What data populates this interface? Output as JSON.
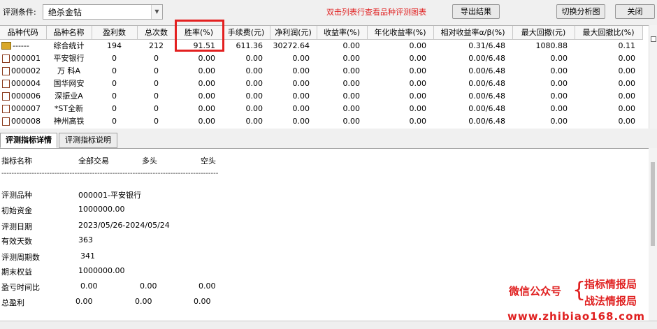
{
  "toolbar": {
    "condition_label": "评测条件:",
    "condition_value": "绝杀金钻",
    "hint": "双击列表行查看品种评测图表",
    "export_label": "导出结果",
    "switch_label": "切换分析图",
    "close_label": "关闭"
  },
  "grid": {
    "columns": [
      "品种代码",
      "品种名称",
      "盈利数",
      "总次数",
      "胜率(%)",
      "手续费(元)",
      "净利润(元)",
      "收益率(%)",
      "年化收益率(%)",
      "相对收益率α/β(%)",
      "最大回撤(元)",
      "最大回撤比(%)"
    ],
    "rows": [
      [
        "------",
        "综合统计",
        "194",
        "212",
        "91.51",
        "611.36",
        "30272.64",
        "0.00",
        "0.00",
        "0.31/6.48",
        "1080.88",
        "0.11"
      ],
      [
        "000001",
        "平安银行",
        "0",
        "0",
        "0.00",
        "0.00",
        "0.00",
        "0.00",
        "0.00",
        "0.00/6.48",
        "0.00",
        "0.00"
      ],
      [
        "000002",
        "万 科A",
        "0",
        "0",
        "0.00",
        "0.00",
        "0.00",
        "0.00",
        "0.00",
        "0.00/6.48",
        "0.00",
        "0.00"
      ],
      [
        "000004",
        "国华网安",
        "0",
        "0",
        "0.00",
        "0.00",
        "0.00",
        "0.00",
        "0.00",
        "0.00/6.48",
        "0.00",
        "0.00"
      ],
      [
        "000006",
        "深振业A",
        "0",
        "0",
        "0.00",
        "0.00",
        "0.00",
        "0.00",
        "0.00",
        "0.00/6.48",
        "0.00",
        "0.00"
      ],
      [
        "000007",
        "*ST全新",
        "0",
        "0",
        "0.00",
        "0.00",
        "0.00",
        "0.00",
        "0.00",
        "0.00/6.48",
        "0.00",
        "0.00"
      ],
      [
        "000008",
        "神州高铁",
        "0",
        "0",
        "0.00",
        "0.00",
        "0.00",
        "0.00",
        "0.00",
        "0.00/6.48",
        "0.00",
        "0.00"
      ]
    ]
  },
  "tabs": [
    "评测指标详情",
    "评测指标说明"
  ],
  "details": {
    "headers": [
      "指标名称",
      "全部交易",
      "多头",
      "空头"
    ],
    "dashes": "--------------------------------------------------------------------------------------",
    "items": [
      {
        "label": "评测品种",
        "values": [
          "000001-平安银行"
        ]
      },
      {
        "label": "初始资金",
        "values": [
          "1000000.00"
        ]
      },
      {
        "label": "评测日期",
        "values": [
          "2023/05/26-2024/05/24"
        ]
      },
      {
        "label": "有效天数",
        "values": [
          "363"
        ]
      },
      {
        "label": "评测周期数",
        "values": [
          "341"
        ]
      },
      {
        "label": "期末权益",
        "values": [
          "1000000.00"
        ]
      },
      {
        "label": "盈亏时间比",
        "values": [
          "0.00",
          "0.00",
          "0.00"
        ]
      },
      {
        "label": "总盈利",
        "values": [
          "0.00",
          "0.00",
          "0.00"
        ]
      }
    ]
  },
  "watermark": {
    "left": "微信公众号",
    "brace": "{",
    "line1": "指标情报局",
    "line2": "战法情报局",
    "url": "www.zhibiao168.com"
  },
  "colors": {
    "accent_red": "#e02020",
    "icon_gold": "#d9a82a"
  }
}
